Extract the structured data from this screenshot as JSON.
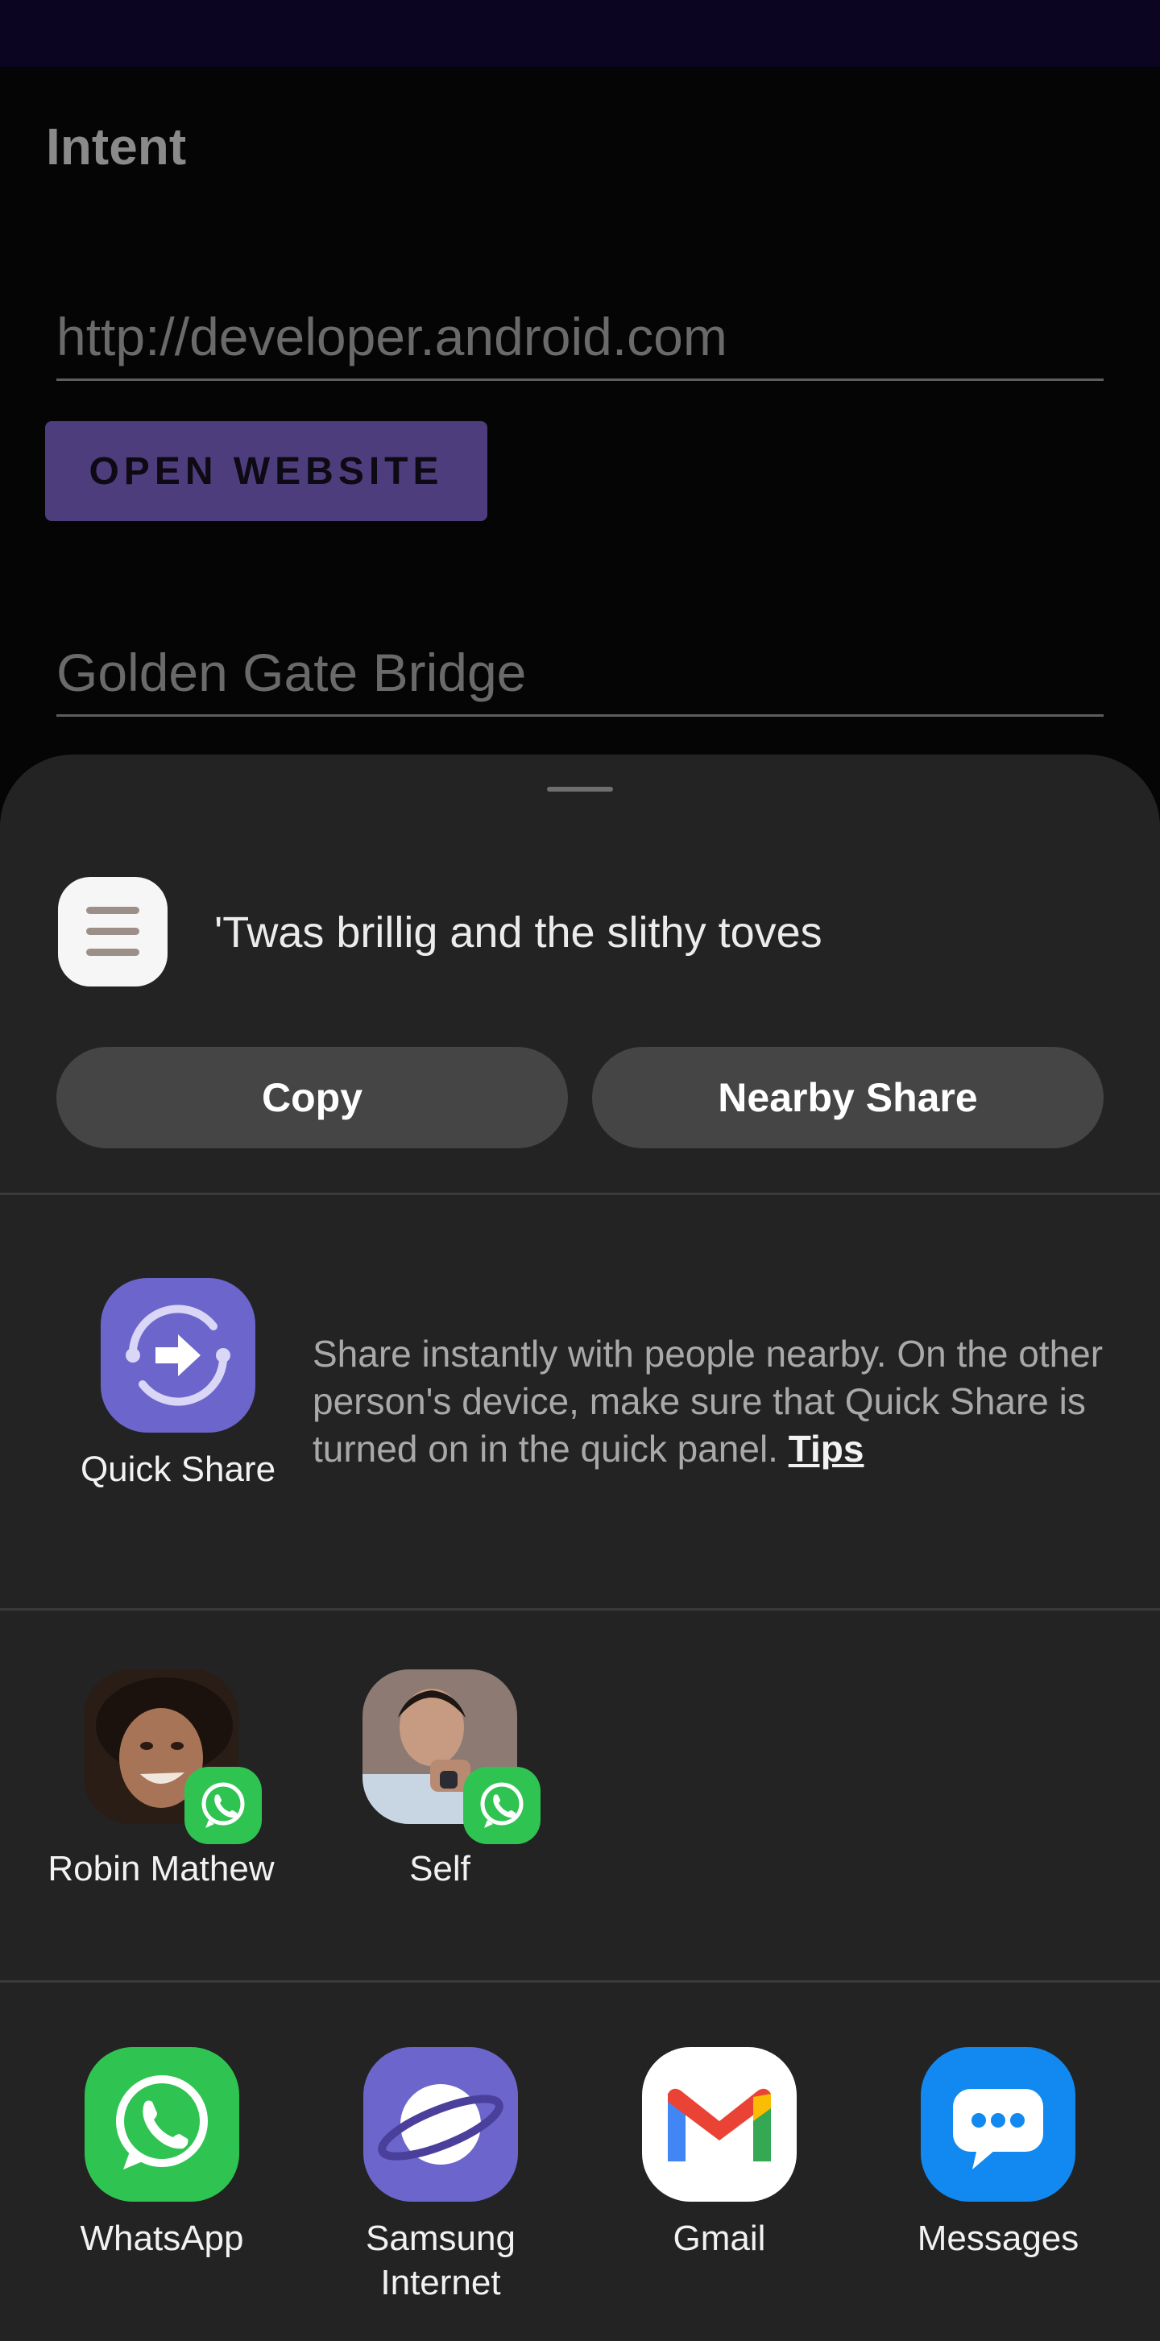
{
  "app": {
    "title": "Intent",
    "url_value": "http://developer.android.com",
    "open_website_label": "OPEN WEBSITE",
    "location_value": "Golden Gate Bridge"
  },
  "share_sheet": {
    "preview_text": "'Twas brillig and the slithy toves",
    "copy_label": "Copy",
    "nearby_share_label": "Nearby Share",
    "quick_share": {
      "label": "Quick Share",
      "description": "Share instantly with people nearby. On the other person's device, make sure that Quick Share is turned on in the quick panel.",
      "tips_label": "Tips"
    },
    "contacts": [
      {
        "name": "Robin Mathew",
        "app_icon": "whatsapp-icon"
      },
      {
        "name": "Self",
        "app_icon": "whatsapp-icon"
      }
    ],
    "apps": [
      {
        "label": "WhatsApp",
        "icon": "whatsapp-icon",
        "color": "#2fc451"
      },
      {
        "label": "Samsung Internet",
        "icon": "samsung-internet-icon",
        "color": "#6c66cc"
      },
      {
        "label": "Gmail",
        "icon": "gmail-icon",
        "color": "#ffffff"
      },
      {
        "label": "Messages",
        "icon": "messages-icon",
        "color": "#1289f0"
      }
    ]
  }
}
